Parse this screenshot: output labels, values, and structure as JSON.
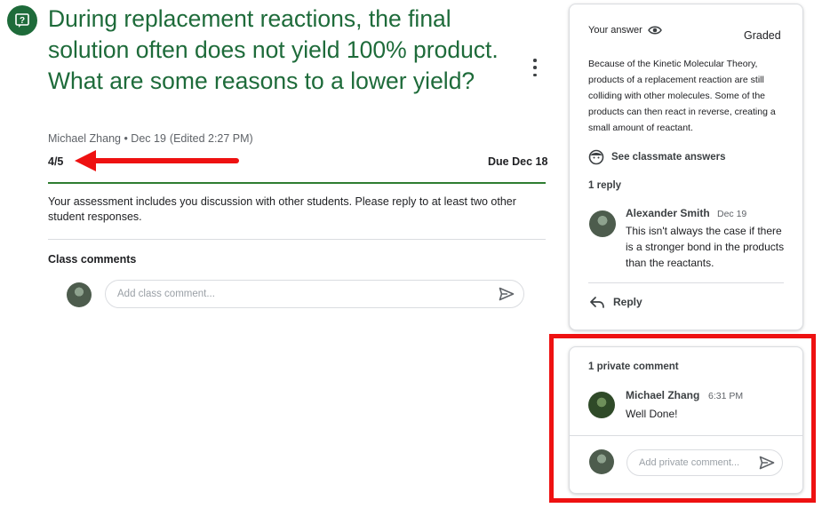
{
  "question": {
    "title": "During replacement reactions, the final solution often does not yield 100% product. What are some reasons to a lower yield?",
    "author_date": "Michael Zhang • Dec 19",
    "edited": "(Edited 2:27 PM)",
    "points": "4/5",
    "due": "Due Dec 18",
    "instructions": "Your assessment includes you discussion with other students. Please reply to at least two other student responses.",
    "class_comments_label": "Class comments",
    "class_comment_placeholder": "Add class comment..."
  },
  "answer_card": {
    "label": "Your answer",
    "status": "Graded",
    "answer_text": "Because of the Kinetic Molecular Theory, products of a replacement reaction are still colliding with other molecules. Some of the products can then react in reverse, creating a small amount of reactant.",
    "see_classmate_label": "See classmate answers",
    "reply_count": "1 reply",
    "reply": {
      "author": "Alexander Smith",
      "date": "Dec 19",
      "text": "This isn't always the case if there is a stronger bond in the products than the reactants."
    },
    "reply_button_label": "Reply"
  },
  "private_comments": {
    "count_label": "1 private comment",
    "comment": {
      "author": "Michael Zhang",
      "time": "6:31 PM",
      "text": "Well Done!"
    },
    "input_placeholder": "Add private comment..."
  },
  "colors": {
    "accent_green": "#1e6b3a",
    "annotation_red": "#ee1111"
  },
  "icons": {
    "question": "question-assignment-icon",
    "visibility": "eye-icon",
    "more": "more-vert-icon",
    "classmates": "face-icon",
    "reply": "reply-arrow-icon",
    "send": "send-icon"
  }
}
